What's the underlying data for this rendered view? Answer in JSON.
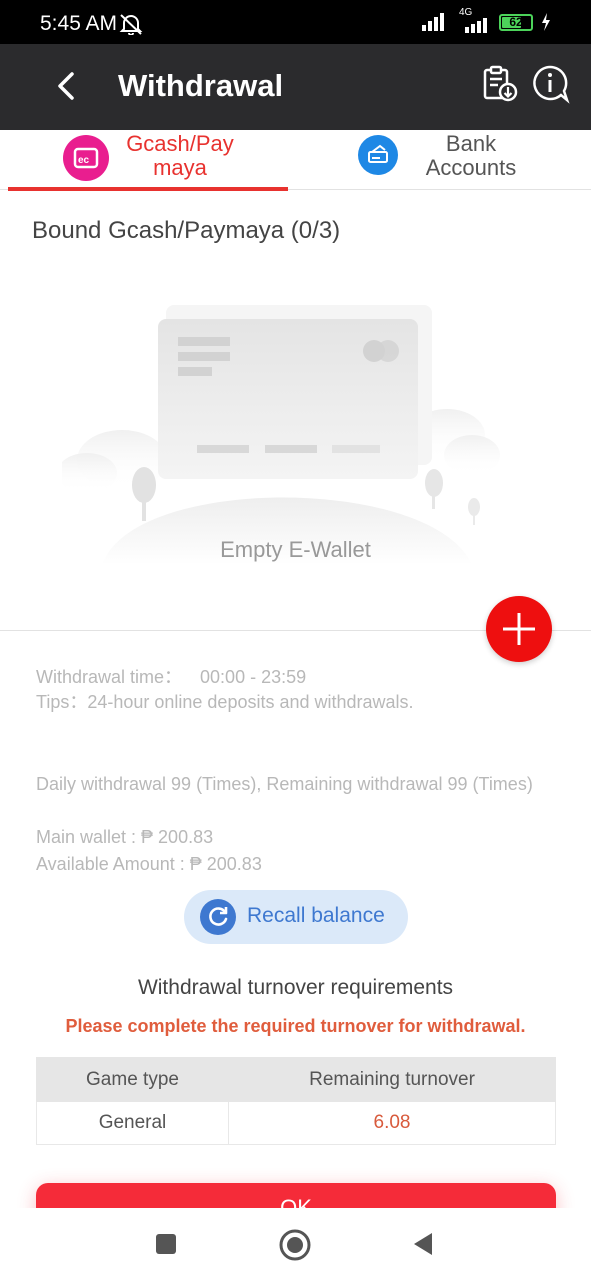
{
  "status_bar": {
    "time": "5:45 AM",
    "network": "4G",
    "battery": "62"
  },
  "header": {
    "title": "Withdrawal",
    "back_icon": "chevron-left-icon",
    "record_icon": "clipboard-download-icon",
    "info_icon": "info-chat-icon"
  },
  "tabs": [
    {
      "label": "Gcash/Pay maya",
      "icon": "wallet-icon",
      "active": true
    },
    {
      "label": "Bank Accounts",
      "icon": "bank-card-icon",
      "active": false
    }
  ],
  "bound_title": "Bound Gcash/Paymaya (0/3)",
  "empty_text": "Empty E-Wallet",
  "info": {
    "withdrawal_time_label": "Withdrawal time：",
    "withdrawal_time_value": "00:00 - 23:59",
    "tips": "Tips：24-hour online deposits and withdrawals.",
    "daily": "Daily withdrawal 99 (Times), Remaining withdrawal 99 (Times)",
    "main_wallet": "Main wallet : ₱ 200.83",
    "available": "Available Amount : ₱ 200.83"
  },
  "recall_label": "Recall balance",
  "turnover": {
    "title": "Withdrawal turnover requirements",
    "warning": "Please complete the required turnover for withdrawal.",
    "headers": [
      "Game type",
      "Remaining turnover"
    ],
    "rows": [
      [
        "General",
        "6.08"
      ]
    ]
  },
  "submit_label": "OK",
  "colors": {
    "accent": "#e8322f",
    "header_bg": "#2b2b2d",
    "recall_blue": "#3e78d0",
    "warn": "#e05d3d"
  }
}
